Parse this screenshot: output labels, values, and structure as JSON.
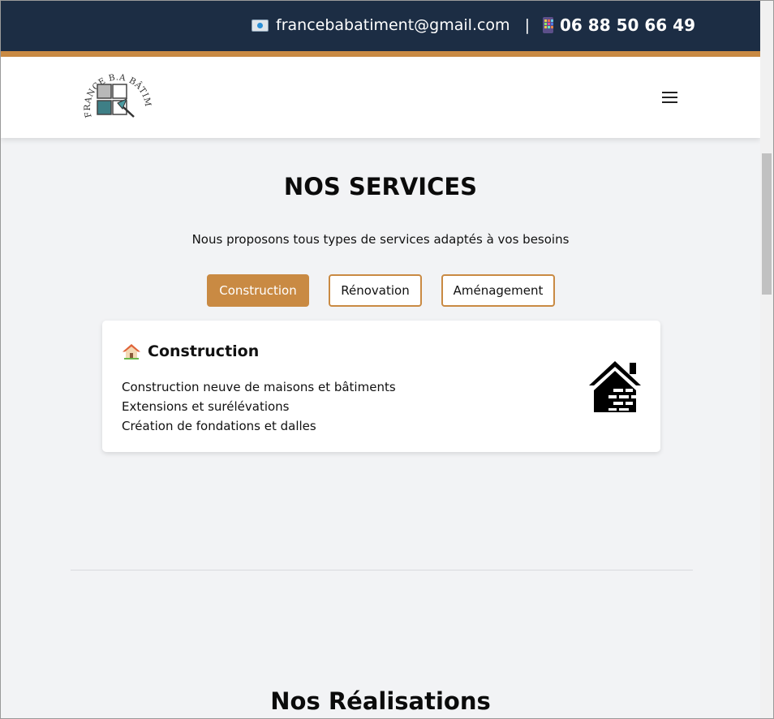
{
  "topbar": {
    "email": "francebabatiment@gmail.com",
    "separator": "|",
    "phone": "06 88 50 66 49",
    "email_icon": "envelope-icon",
    "phone_icon": "mobile-phone-icon",
    "bg_color": "#1c2d44",
    "accent_color": "#c98a43"
  },
  "header": {
    "logo_text": "FRANCE B.A BÂTIMENT",
    "menu_icon": "hamburger-icon"
  },
  "services": {
    "title": "NOS SERVICES",
    "subtitle": "Nous proposons tous types de services adaptés à vos besoins",
    "tabs": [
      {
        "label": "Construction",
        "active": true
      },
      {
        "label": "Rénovation",
        "active": false
      },
      {
        "label": "Aménagement",
        "active": false
      }
    ],
    "card": {
      "icon": "house-emoji-icon",
      "title": "Construction",
      "items": [
        "Construction neuve de maisons et bâtiments",
        "Extensions et surélévations",
        "Création de fondations et dalles"
      ],
      "illustration": "brick-house-icon"
    }
  },
  "realisations": {
    "title": "Nos Réalisations"
  }
}
